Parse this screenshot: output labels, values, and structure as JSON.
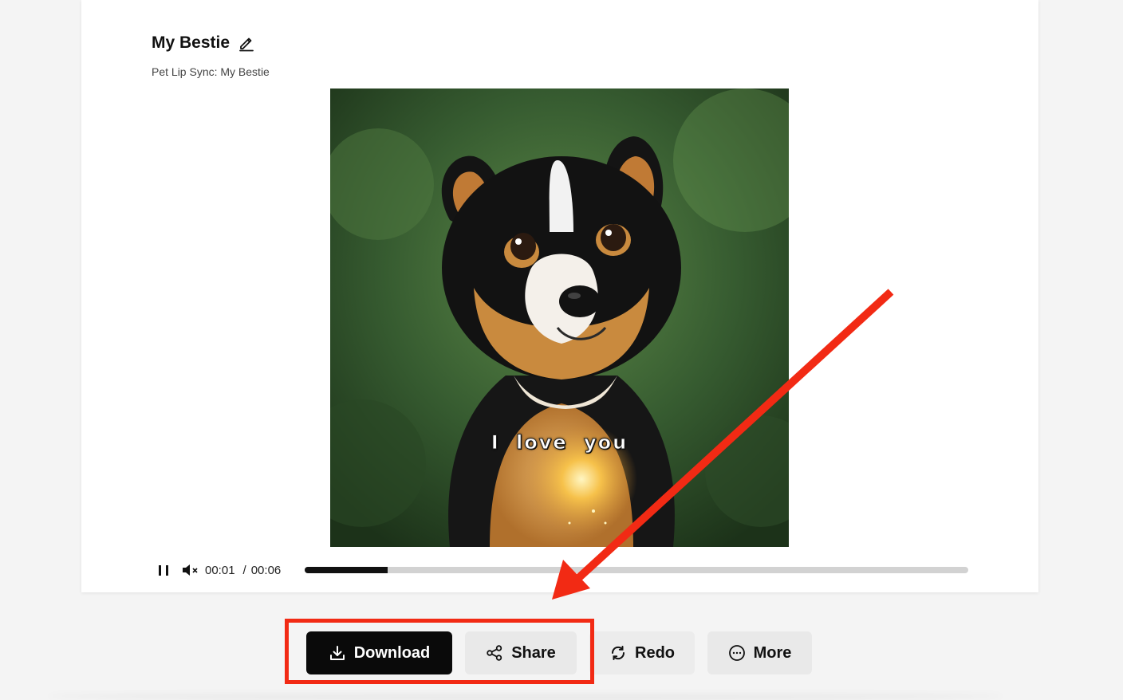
{
  "project": {
    "title": "My Bestie",
    "subtitle": "Pet Lip Sync: My Bestie"
  },
  "video": {
    "caption": "I love you",
    "current_time": "00:01",
    "duration": "00:06",
    "time_separator": "/",
    "progress_fraction": 0.125,
    "muted": true,
    "playing": true
  },
  "actions": {
    "download_label": "Download",
    "share_label": "Share",
    "redo_label": "Redo",
    "more_label": "More"
  },
  "icons": {
    "edit": "pencil-icon",
    "pause": "pause-icon",
    "mute": "speaker-muted-icon",
    "download": "download-icon",
    "share": "share-icon",
    "redo": "refresh-icon",
    "more": "ellipsis-circle-icon"
  },
  "colors": {
    "annotation": "#f22a14",
    "primary_button": "#0a0a0a",
    "secondary_button": "#e9e9e9"
  }
}
